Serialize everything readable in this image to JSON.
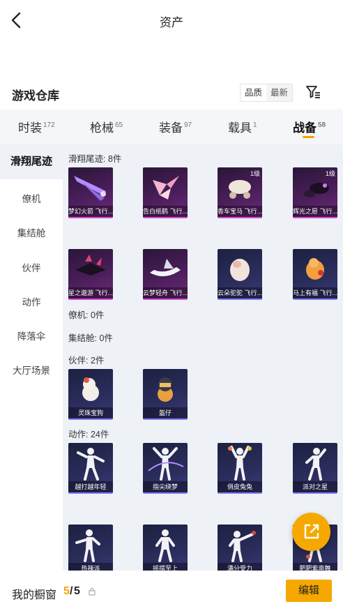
{
  "header": {
    "title": "资产"
  },
  "section": {
    "title": "游戏仓库",
    "sort_options": [
      "品质",
      "最新"
    ]
  },
  "tabs": [
    {
      "label": "时装",
      "count": "172"
    },
    {
      "label": "枪械",
      "count": "65"
    },
    {
      "label": "装备",
      "count": "97"
    },
    {
      "label": "载具",
      "count": "1"
    },
    {
      "label": "战备",
      "count": "58"
    }
  ],
  "sidebar": [
    "滑翔尾迹",
    "僚机",
    "集结舱",
    "伙伴",
    "动作",
    "降落伞",
    "大厅场景"
  ],
  "groups": {
    "trail": {
      "label": "滑翔尾迹: 8件",
      "items": [
        {
          "name": "梦幻火箭 飞行...",
          "level": ""
        },
        {
          "name": "告白纸鹤 飞行...",
          "level": ""
        },
        {
          "name": "香车宝马 飞行...",
          "level": "1级"
        },
        {
          "name": "辉光之愿 飞行...",
          "level": "1级"
        },
        {
          "name": "星之遨游 飞行...",
          "level": ""
        },
        {
          "name": "云梦轻舟 飞行...",
          "level": ""
        },
        {
          "name": "云朵驼驼 飞行...",
          "level": ""
        },
        {
          "name": "马上有福 飞行...",
          "level": ""
        }
      ]
    },
    "wingman": {
      "label": "僚机: 0件"
    },
    "pod": {
      "label": "集结舱: 0件"
    },
    "partner": {
      "label": "伙伴: 2件",
      "items": [
        {
          "name": "灵珠宝狗"
        },
        {
          "name": "盔仔"
        }
      ]
    },
    "emote": {
      "label": "动作: 24件",
      "items": [
        {
          "name": "越打越年轻"
        },
        {
          "name": "指尖绕梦"
        },
        {
          "name": "俏皮兔兔"
        },
        {
          "name": "派对之星"
        },
        {
          "name": "热辣派"
        },
        {
          "name": "摇摆至上"
        },
        {
          "name": "满分受力"
        },
        {
          "name": "肥肥紫南舞"
        }
      ]
    }
  },
  "bottom": {
    "showcase_label": "我的橱窗",
    "count_current": "5",
    "count_sep": "/",
    "count_max": "5",
    "edit_label": "编辑"
  },
  "colors": {
    "accent": "#f5a800",
    "tab_bg": "#f4f6f9",
    "content_bg": "#eef2f7",
    "rare_border": "#d84bd6",
    "epic_border": "#8a7bff"
  }
}
